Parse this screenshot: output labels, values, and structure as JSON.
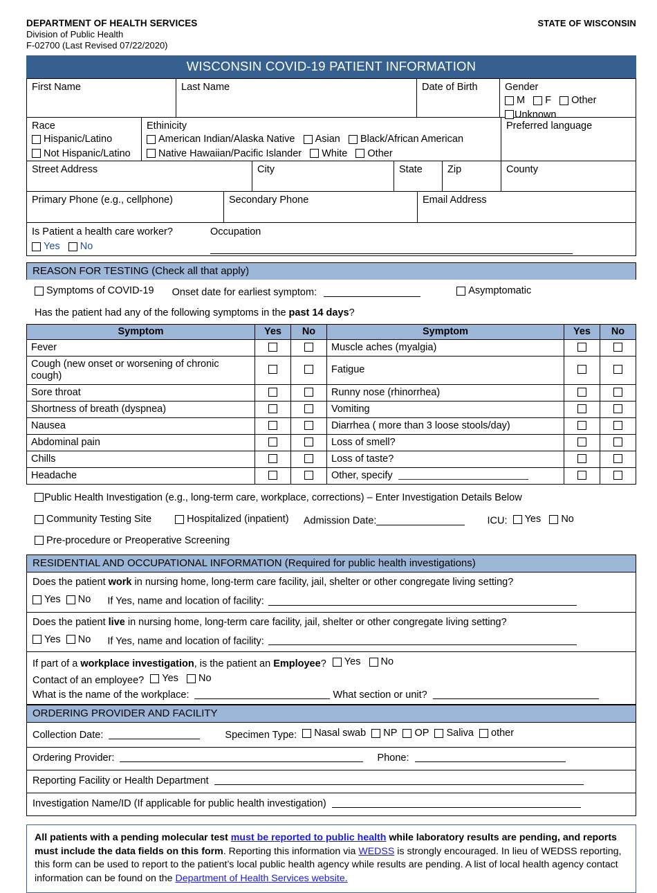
{
  "letterhead": {
    "department": "DEPARTMENT OF HEALTH SERVICES",
    "division": "Division of Public Health",
    "form_id": "F-02700 (Last Revised 07/22/2020)",
    "state": "STATE OF WISCONSIN"
  },
  "title": "WISCONSIN COVID-19 PATIENT INFORMATION",
  "identity": {
    "first_name_label": "First Name",
    "last_name_label": "Last Name",
    "dob_label": "Date of Birth",
    "gender_label": "Gender",
    "gender_options": [
      "M",
      "F",
      "Other",
      "Unknown"
    ]
  },
  "race_ethnicity": {
    "race_label": "Race",
    "race_options": [
      "Hispanic/Latino",
      "Not Hispanic/Latino"
    ],
    "ethnicity_label": "Ethinicity",
    "ethnicity_options_row1": [
      "American Indian/Alaska Native",
      "Asian",
      "Black/African American"
    ],
    "ethnicity_options_row2": [
      "Native Hawaiian/Pacific Islander",
      "White",
      "Other"
    ],
    "language_label": "Preferred language"
  },
  "address": {
    "street_label": "Street Address",
    "city_label": "City",
    "state_label": "State",
    "zip_label": "Zip",
    "county_label": "County"
  },
  "contact": {
    "primary_phone_label": "Primary Phone (e.g., cellphone)",
    "secondary_phone_label": "Secondary Phone",
    "email_label": "Email Address"
  },
  "worker": {
    "question": "Is Patient a health care worker?",
    "yes": "Yes",
    "no": "No",
    "occupation_label": "Occupation"
  },
  "reason": {
    "header": "REASON FOR TESTING (Check all that apply)",
    "symptoms_option": "Symptoms of COVID-19",
    "onset_label": "Onset date for earliest symptom:",
    "asymptomatic_option": "Asymptomatic",
    "past14_prefix": "Has the patient had any of the following symptoms in the ",
    "past14_bold": "past 14 days",
    "past14_suffix": "?"
  },
  "symptom_table": {
    "columns": [
      "Symptom",
      "Yes",
      "No",
      "Symptom",
      "Yes",
      "No"
    ],
    "rows": [
      {
        "left": "Fever",
        "right": "Muscle aches (myalgia)"
      },
      {
        "left": "Cough (new onset or worsening of chronic cough)",
        "right": "Fatigue"
      },
      {
        "left": "Sore throat",
        "right": "Runny nose (rhinorrhea)"
      },
      {
        "left": "Shortness of breath (dyspnea)",
        "right": "Vomiting"
      },
      {
        "left": "Nausea",
        "right": "Diarrhea ( more than 3 loose stools/day)"
      },
      {
        "left": "Abdominal pain",
        "right": "Loss of smell?"
      },
      {
        "left": "Chills",
        "right": "Loss of taste?"
      },
      {
        "left": "Headache",
        "right": "Other, specify"
      }
    ]
  },
  "investigation": {
    "public_health": "Public Health Investigation (e.g., long-term care, workplace, corrections) – Enter Investigation Details Below",
    "community_site": "Community Testing Site",
    "hospitalized": "Hospitalized (inpatient)",
    "admission_label": "Admission Date:",
    "icu_label": "ICU:",
    "icu_yes": "Yes",
    "icu_no": "No",
    "preprocedure": "Pre-procedure or Preoperative Screening"
  },
  "residential": {
    "header": "RESIDENTIAL AND OCCUPATIONAL INFORMATION (Required for public health investigations)",
    "work_q_pre": "Does the patient ",
    "work_q_bold": "work",
    "work_q_post": " in nursing home, long-term care facility, jail, shelter or other congregate living setting?",
    "live_q_pre": "Does the patient ",
    "live_q_bold": "live",
    "live_q_post": " in nursing home, long-term care facility, jail, shelter or other congregate living setting?",
    "yes": "Yes",
    "no": "No",
    "facility_label": "If Yes, name and location of facility:",
    "workplace_pre": "If part of a ",
    "workplace_bold": "workplace investigation",
    "workplace_mid": ", is the patient an ",
    "workplace_bold2": "Employee",
    "workplace_post": "?",
    "contact_q": "Contact of an employee?",
    "workplace_name_label": "What is the name of the workplace:",
    "section_unit_label": "What section or unit?"
  },
  "ordering": {
    "header": "ORDERING PROVIDER AND FACILITY",
    "collection_label": "Collection Date:",
    "specimen_label": "Specimen Type:",
    "specimen_options": [
      "Nasal swab",
      "NP",
      "OP",
      "Saliva",
      "other"
    ],
    "provider_label": "Ordering Provider:",
    "phone_label": "Phone:",
    "facility_label": "Reporting Facility or Health Department",
    "investigation_id_label": "Investigation Name/ID (If applicable for public health investigation)"
  },
  "notice": {
    "b1": "All patients with a pending molecular test ",
    "link1": "must be reported to public health",
    "b2": " while laboratory results are pending, and reports must include the data fields on this form",
    "t1": ". Reporting this information via ",
    "link2": "WEDSS",
    "t2": " is strongly encouraged. In lieu of WEDSS reporting, this form can be used to report to the patient’s local public health agency while results are pending. A list of local health agency contact information can be found on the ",
    "link3": "Department of Health Services website."
  },
  "colors": {
    "title_bar": "#35608F",
    "section_band": "#9DB7D9",
    "link": "#1A1AE6",
    "notice_border": "#3B5FB0",
    "blue_text": "#1F4E9C"
  }
}
